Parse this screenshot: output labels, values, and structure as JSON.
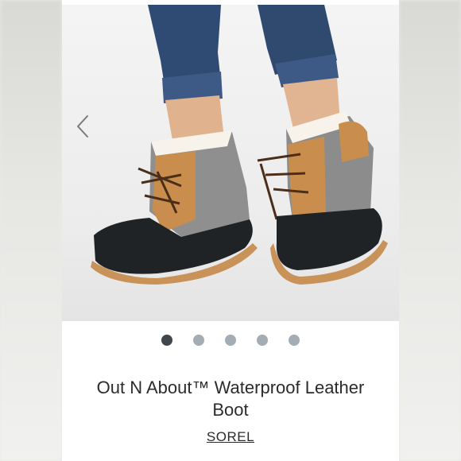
{
  "product": {
    "title": "Out N About™ Waterproof Leather Boot",
    "brand": "SOREL"
  },
  "carousel": {
    "dot_count": 5,
    "active_index": 0
  },
  "colors": {
    "active_dot": "#3f474c",
    "inactive_dot": "#a3adb3",
    "text": "#2b2b2b"
  },
  "icons": {
    "prev": "chevron-left-icon"
  }
}
